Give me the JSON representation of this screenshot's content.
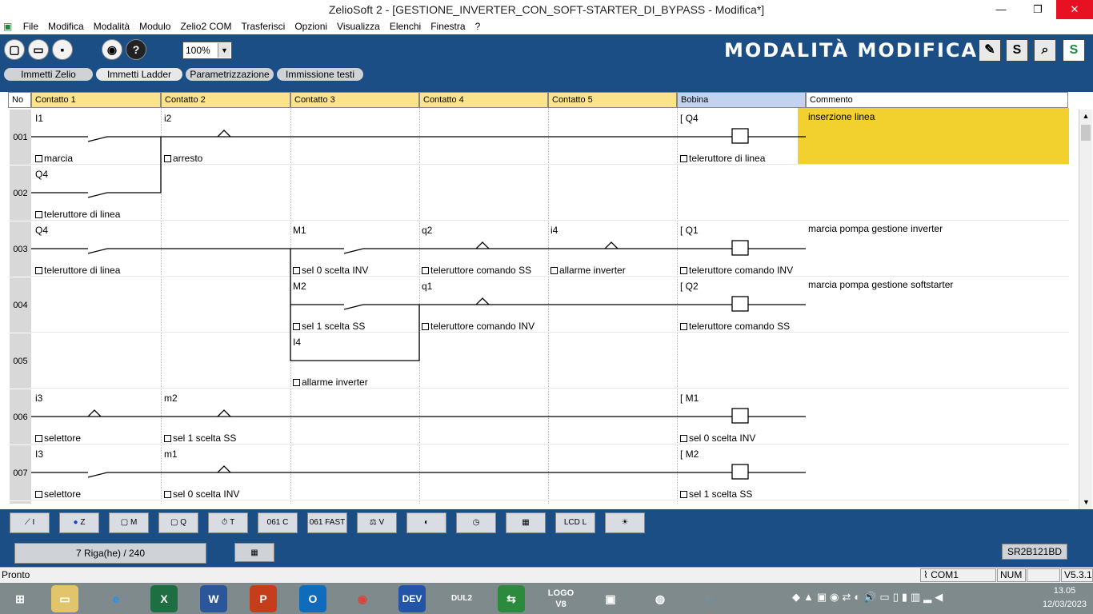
{
  "window": {
    "title": "ZelioSoft 2 - [GESTIONE_INVERTER_CON_SOFT-STARTER_DI_BYPASS - Modifica*]"
  },
  "menu": [
    "File",
    "Modifica",
    "Modalità",
    "Modulo",
    "Zelio2 COM",
    "Trasferisci",
    "Opzioni",
    "Visualizza",
    "Elenchi",
    "Finestra",
    "?"
  ],
  "toolbar": {
    "zoom": "100%",
    "mode": "MODALITÀ MODIFICA",
    "s_btn": "S"
  },
  "tabs": [
    "Immetti Zelio",
    "Immetti Ladder",
    "Parametrizzazione",
    "Immissione testi"
  ],
  "headers": [
    "No",
    "Contatto 1",
    "Contatto 2",
    "Contatto 3",
    "Contatto 4",
    "Contatto 5",
    "Bobina",
    "Commento"
  ],
  "rows": [
    "001",
    "002",
    "003",
    "004",
    "005",
    "006",
    "007"
  ],
  "contacts": [
    {
      "name": "I1",
      "label": "marcia"
    },
    {
      "name": "i2",
      "label": "arresto"
    },
    {
      "name": "Q4",
      "label": "teleruttore di linea"
    },
    {
      "name": "Q4",
      "label": "teleruttore di linea"
    },
    {
      "name": "Q4",
      "label": "teleruttore di linea"
    },
    {
      "name": "M1",
      "label": "sel 0 scelta INV"
    },
    {
      "name": "q2",
      "label": "teleruttore comando SS"
    },
    {
      "name": "i4",
      "label": "allarme inverter"
    },
    {
      "name": "Q1",
      "label": "teleruttore comando INV"
    },
    {
      "name": "M2",
      "label": "sel 1 scelta SS"
    },
    {
      "name": "q1",
      "label": "teleruttore comando INV"
    },
    {
      "name": "Q2",
      "label": "teleruttore comando SS"
    },
    {
      "name": "I4",
      "label": "allarme inverter"
    },
    {
      "name": "i3",
      "label": "selettore"
    },
    {
      "name": "m2",
      "label": "sel 1 scelta SS"
    },
    {
      "name": "M1",
      "label": "sel 0 scelta INV"
    },
    {
      "name": "I3",
      "label": "selettore"
    },
    {
      "name": "m1",
      "label": "sel 0 scelta INV"
    },
    {
      "name": "M2",
      "label": "sel 1 scelta SS"
    }
  ],
  "comments": [
    "inserzione linea",
    "marcia pompa gestione inverter",
    "marcia pompa gestione softstarter"
  ],
  "strip": [
    "I",
    "Z",
    "M",
    "Q",
    "T",
    "C",
    "FAST",
    "V",
    "",
    "",
    "",
    "",
    "L",
    ""
  ],
  "info": {
    "rows": "7 Riga(he) / 240",
    "model": "SR2B121BD"
  },
  "status": {
    "text": "Pronto",
    "com": "COM1",
    "num": "NUM",
    "version": "V5.3.1"
  },
  "clock": {
    "time": "13.05",
    "date": "12/03/2023"
  },
  "taskbar": [
    "DEV",
    "LOGO V8",
    "DUL2"
  ]
}
